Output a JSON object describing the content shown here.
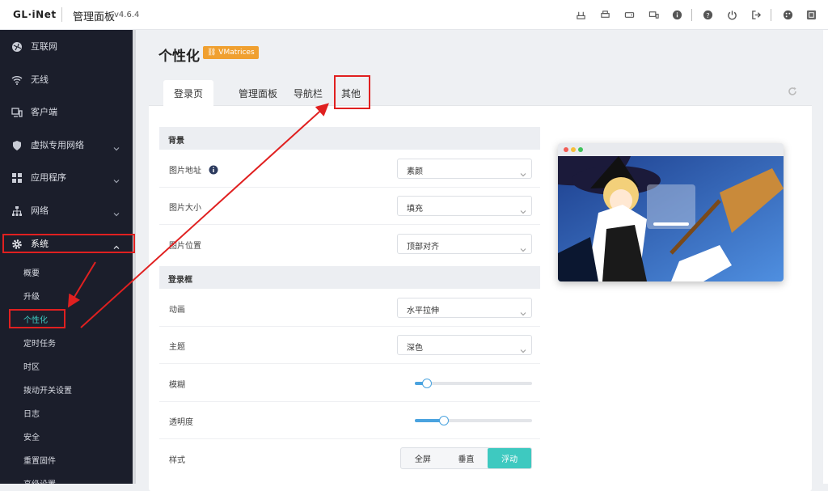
{
  "header": {
    "brand": "GL·iNet",
    "title": "管理面板",
    "version": "v4.6.4",
    "icons": [
      "network-icon",
      "printer-icon",
      "drive-icon",
      "devices-icon",
      "info-icon",
      "help-icon",
      "power-icon",
      "logout-icon",
      "theme-icon",
      "language-icon"
    ]
  },
  "sidebar": {
    "items": [
      {
        "label": "互联网",
        "icon": "globe-icon",
        "expandable": false
      },
      {
        "label": "无线",
        "icon": "wifi-icon",
        "expandable": false
      },
      {
        "label": "客户端",
        "icon": "clients-icon",
        "expandable": false
      },
      {
        "label": "虚拟专用网络",
        "icon": "shield-icon",
        "expandable": true
      },
      {
        "label": "应用程序",
        "icon": "apps-icon",
        "expandable": true
      },
      {
        "label": "网络",
        "icon": "network-tree-icon",
        "expandable": true
      },
      {
        "label": "系统",
        "icon": "gear-icon",
        "expandable": true,
        "expanded": true
      }
    ],
    "sub_items": [
      "概要",
      "升级",
      "个性化",
      "定时任务",
      "时区",
      "拨动开关设置",
      "日志",
      "安全",
      "重置固件",
      "高级设置"
    ],
    "active_sub": "个性化"
  },
  "page": {
    "title": "个性化",
    "badge": "VMatrices"
  },
  "tabs": [
    {
      "label": "登录页",
      "active": true
    },
    {
      "label": "管理面板",
      "active": false
    },
    {
      "label": "导航栏",
      "active": false
    },
    {
      "label": "其他",
      "active": false
    }
  ],
  "sections": {
    "background": {
      "title": "背景",
      "image_url_label": "图片地址",
      "image_url_value": "素颜",
      "image_size_label": "图片大小",
      "image_size_value": "填充",
      "image_pos_label": "图片位置",
      "image_pos_value": "顶部对齐"
    },
    "login_box": {
      "title": "登录框",
      "animation_label": "动画",
      "animation_value": "水平拉伸",
      "theme_label": "主题",
      "theme_value": "深色",
      "blur_label": "模糊",
      "blur_level": 0.1,
      "opacity_label": "透明度",
      "opacity_level": 0.25,
      "style_label": "样式",
      "style_options": [
        "全屏",
        "垂直",
        "浮动"
      ],
      "style_selected": "浮动"
    }
  },
  "colors": {
    "sidebar_bg": "#1b1e2b",
    "accent": "#3ec9c0",
    "badge": "#f0a030",
    "slider": "#4aa3df",
    "annotation": "#e02020"
  }
}
